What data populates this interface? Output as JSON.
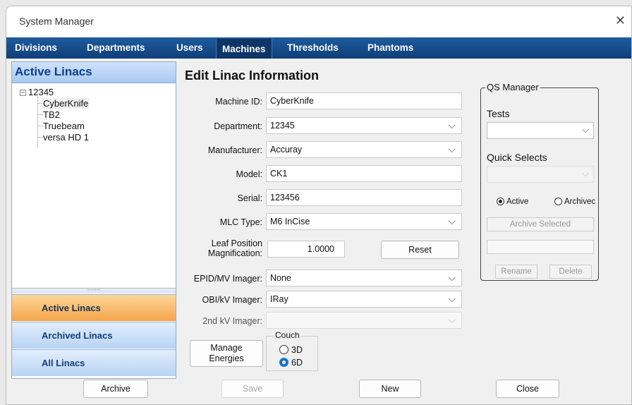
{
  "window": {
    "title": "System Manager",
    "close_glyph": "✕"
  },
  "tabs": [
    {
      "label": "Divisions"
    },
    {
      "label": "Departments"
    },
    {
      "label": "Users"
    },
    {
      "label": "Machines",
      "active": true
    },
    {
      "label": "Thresholds"
    },
    {
      "label": "Phantoms"
    }
  ],
  "sidebar": {
    "header": "Active Linacs",
    "tree": {
      "root": "12345",
      "root_toggle": "−",
      "items": [
        "CyberKnife",
        "TB2",
        "Truebeam",
        "versa HD 1"
      ]
    },
    "splitter_grip": "·······",
    "nav": [
      {
        "label": "Active Linacs",
        "active": true
      },
      {
        "label": "Archived Linacs"
      },
      {
        "label": "All Linacs"
      }
    ]
  },
  "form": {
    "title": "Edit Linac Information",
    "machine_id": {
      "label": "Machine ID:",
      "value": "CyberKnife"
    },
    "department": {
      "label": "Department:",
      "value": "12345"
    },
    "manufacturer": {
      "label": "Manufacturer:",
      "value": "Accuray"
    },
    "model": {
      "label": "Model:",
      "value": "CK1"
    },
    "serial": {
      "label": "Serial:",
      "value": "123456"
    },
    "mlc_type": {
      "label": "MLC Type:",
      "value": "M6 InCise"
    },
    "leaf_position": {
      "label_line1": "Leaf Position",
      "label_line2": "Magnification:",
      "value": "1.0000"
    },
    "reset_label": "Reset",
    "epid": {
      "label": "EPID/MV Imager:",
      "value": "None"
    },
    "obi": {
      "label": "OBI/kV Imager:",
      "value": "IRay"
    },
    "kv2": {
      "label": "2nd kV Imager:",
      "value": ""
    },
    "manage_energies_line1": "Manage",
    "manage_energies_line2": "Energies",
    "couch": {
      "legend": "Couch",
      "options": [
        "3D",
        "6D"
      ],
      "selected": "6D"
    }
  },
  "qs_manager": {
    "legend": "QS Manager",
    "tests_label": "Tests",
    "quick_selects_label": "Quick Selects",
    "radio_active": "Active",
    "radio_archived": "Archivec",
    "archive_selected": "Archive Selected",
    "rename": "Rename",
    "delete": "Delete"
  },
  "bottom_buttons": {
    "archive": "Archive",
    "save": "Save",
    "new": "New",
    "close": "Close"
  },
  "colors": {
    "tabbar": "#164a8a",
    "active_nav": "#f5a44a",
    "nav": "#b8d3f4",
    "radio_selected": "#1670c8"
  }
}
